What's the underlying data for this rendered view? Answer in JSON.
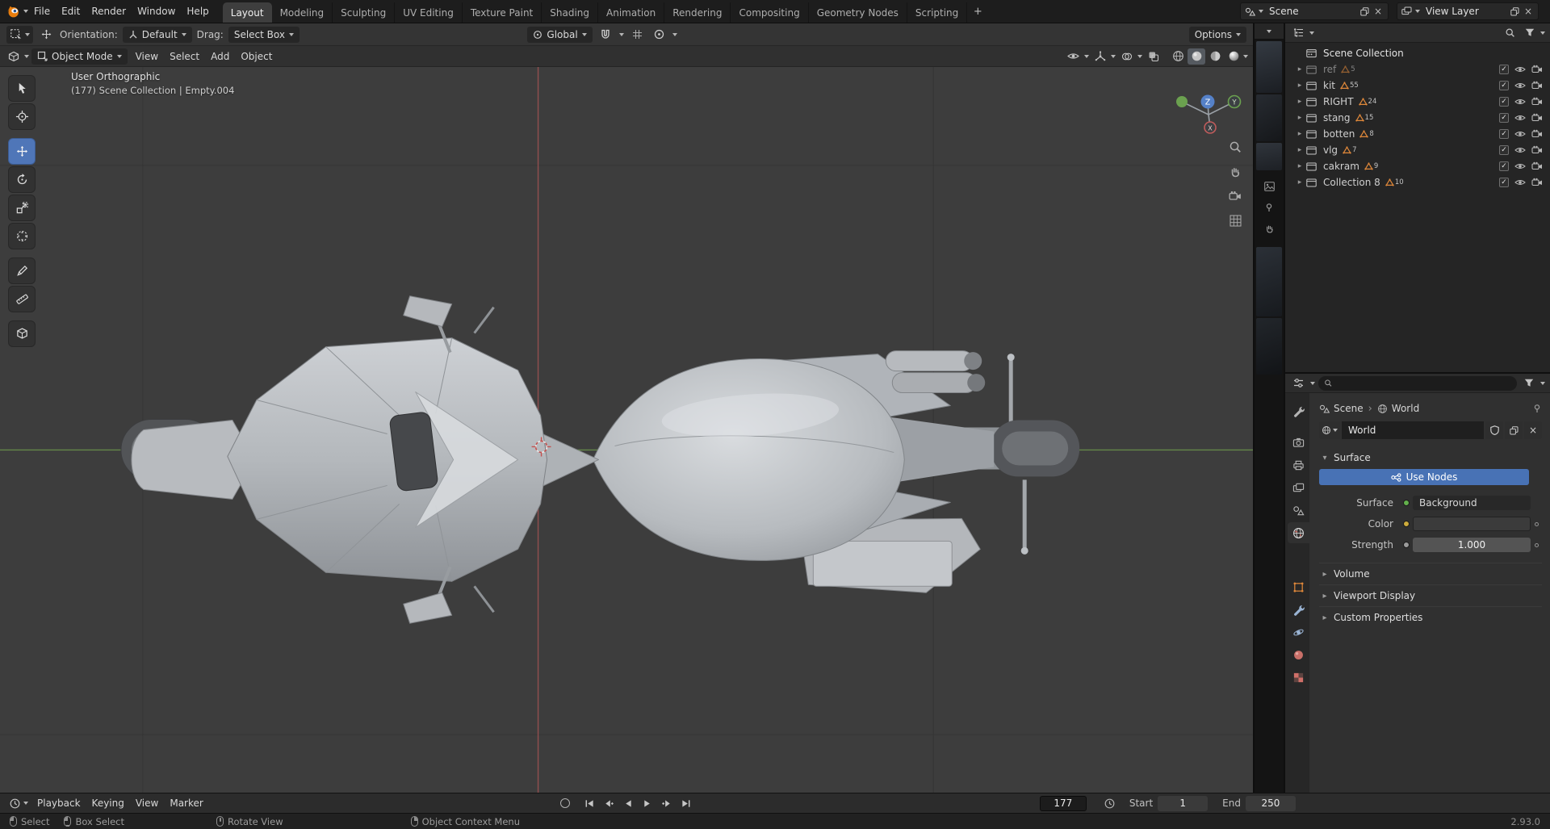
{
  "topbar": {
    "menus": [
      {
        "label": "File"
      },
      {
        "label": "Edit"
      },
      {
        "label": "Render"
      },
      {
        "label": "Window"
      },
      {
        "label": "Help"
      }
    ],
    "workspaces": [
      {
        "label": "Layout",
        "active": true
      },
      {
        "label": "Modeling"
      },
      {
        "label": "Sculpting"
      },
      {
        "label": "UV Editing"
      },
      {
        "label": "Texture Paint"
      },
      {
        "label": "Shading"
      },
      {
        "label": "Animation"
      },
      {
        "label": "Rendering"
      },
      {
        "label": "Compositing"
      },
      {
        "label": "Geometry Nodes"
      },
      {
        "label": "Scripting"
      }
    ],
    "add_tab": "+",
    "scene_name": "Scene",
    "view_layer_name": "View Layer"
  },
  "tool_settings": {
    "orientation_label": "Orientation:",
    "orientation_value": "Default",
    "drag_label": "Drag:",
    "drag_value": "Select Box",
    "pivot_value": "Global",
    "options_label": "Options"
  },
  "viewport": {
    "mode": "Object Mode",
    "menus": [
      {
        "label": "View"
      },
      {
        "label": "Select"
      },
      {
        "label": "Add"
      },
      {
        "label": "Object"
      }
    ],
    "overlay_line1": "User Orthographic",
    "overlay_line2": "(177) Scene Collection | Empty.004",
    "axis_z": "Z",
    "axis_y": "Y",
    "axis_x": "X"
  },
  "outliner": {
    "root": "Scene Collection",
    "items": [
      {
        "name": "ref",
        "count": "5",
        "dim": true,
        "image": true
      },
      {
        "name": "kit",
        "count": "55"
      },
      {
        "name": "RIGHT",
        "count": "24"
      },
      {
        "name": "stang",
        "count": "15"
      },
      {
        "name": "botten",
        "count": "8"
      },
      {
        "name": "vlg",
        "count": "7"
      },
      {
        "name": "cakram",
        "count": "9"
      },
      {
        "name": "Collection 8",
        "count": "10"
      }
    ]
  },
  "properties": {
    "search_value": "",
    "breadcrumb_scene": "Scene",
    "breadcrumb_world": "World",
    "world_name": "World",
    "surface_title": "Surface",
    "use_nodes_label": "Use Nodes",
    "surface_label": "Surface",
    "surface_value": "Background",
    "color_label": "Color",
    "strength_label": "Strength",
    "strength_value": "1.000",
    "sections": [
      {
        "title": "Volume"
      },
      {
        "title": "Viewport Display"
      },
      {
        "title": "Custom Properties"
      }
    ],
    "tabs": [
      "tool",
      "render",
      "output",
      "view-layer",
      "scene",
      "world",
      "object",
      "modifiers",
      "physics",
      "material",
      "texture"
    ],
    "active_tab": "world"
  },
  "timeline": {
    "menus": [
      {
        "label": "Playback"
      },
      {
        "label": "Keying"
      },
      {
        "label": "View"
      },
      {
        "label": "Marker"
      }
    ],
    "current_frame": "177",
    "start_label": "Start",
    "start_value": "1",
    "end_label": "End",
    "end_value": "250"
  },
  "status_bar": {
    "hints": [
      {
        "label": "Select",
        "btn": "m-left"
      },
      {
        "label": "Box Select",
        "btn": "m-drag"
      },
      {
        "label": "Rotate View",
        "btn": "m-mid"
      },
      {
        "label": "Object Context Menu",
        "btn": "m-right"
      }
    ],
    "version": "2.93.0"
  },
  "colors": {
    "accent": "#4872b5",
    "collection_orange": "#e0883a",
    "axis_x": "#c05b5b",
    "axis_y": "#6ba14f",
    "axis_z": "#5581c8"
  }
}
